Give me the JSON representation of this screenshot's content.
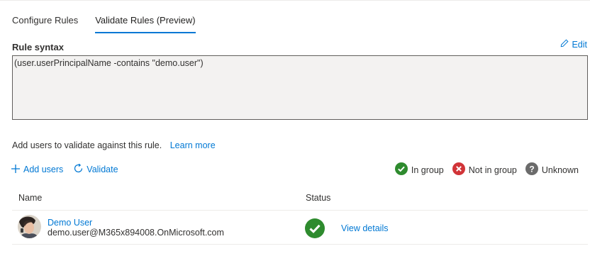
{
  "tabs": [
    {
      "label": "Configure Rules"
    },
    {
      "label": "Validate Rules (Preview)"
    }
  ],
  "rule": {
    "label": "Rule syntax",
    "edit_label": "Edit",
    "syntax": "(user.userPrincipalName -contains \"demo.user\")"
  },
  "validate": {
    "description": "Add users to validate against this rule.",
    "learn_more": "Learn more",
    "add_users": "Add users",
    "validate_label": "Validate"
  },
  "legend": {
    "in_group": "In group",
    "not_in_group": "Not in group",
    "unknown": "Unknown"
  },
  "table": {
    "headers": {
      "name": "Name",
      "status": "Status"
    },
    "rows": [
      {
        "name": "Demo User",
        "email": "demo.user@M365x894008.OnMicrosoft.com",
        "status": "in_group",
        "action": "View details"
      }
    ]
  },
  "colors": {
    "accent": "#0078d4",
    "in_group": "#2e8b2e",
    "not_in_group": "#d13438",
    "unknown": "#6b6b6b"
  }
}
